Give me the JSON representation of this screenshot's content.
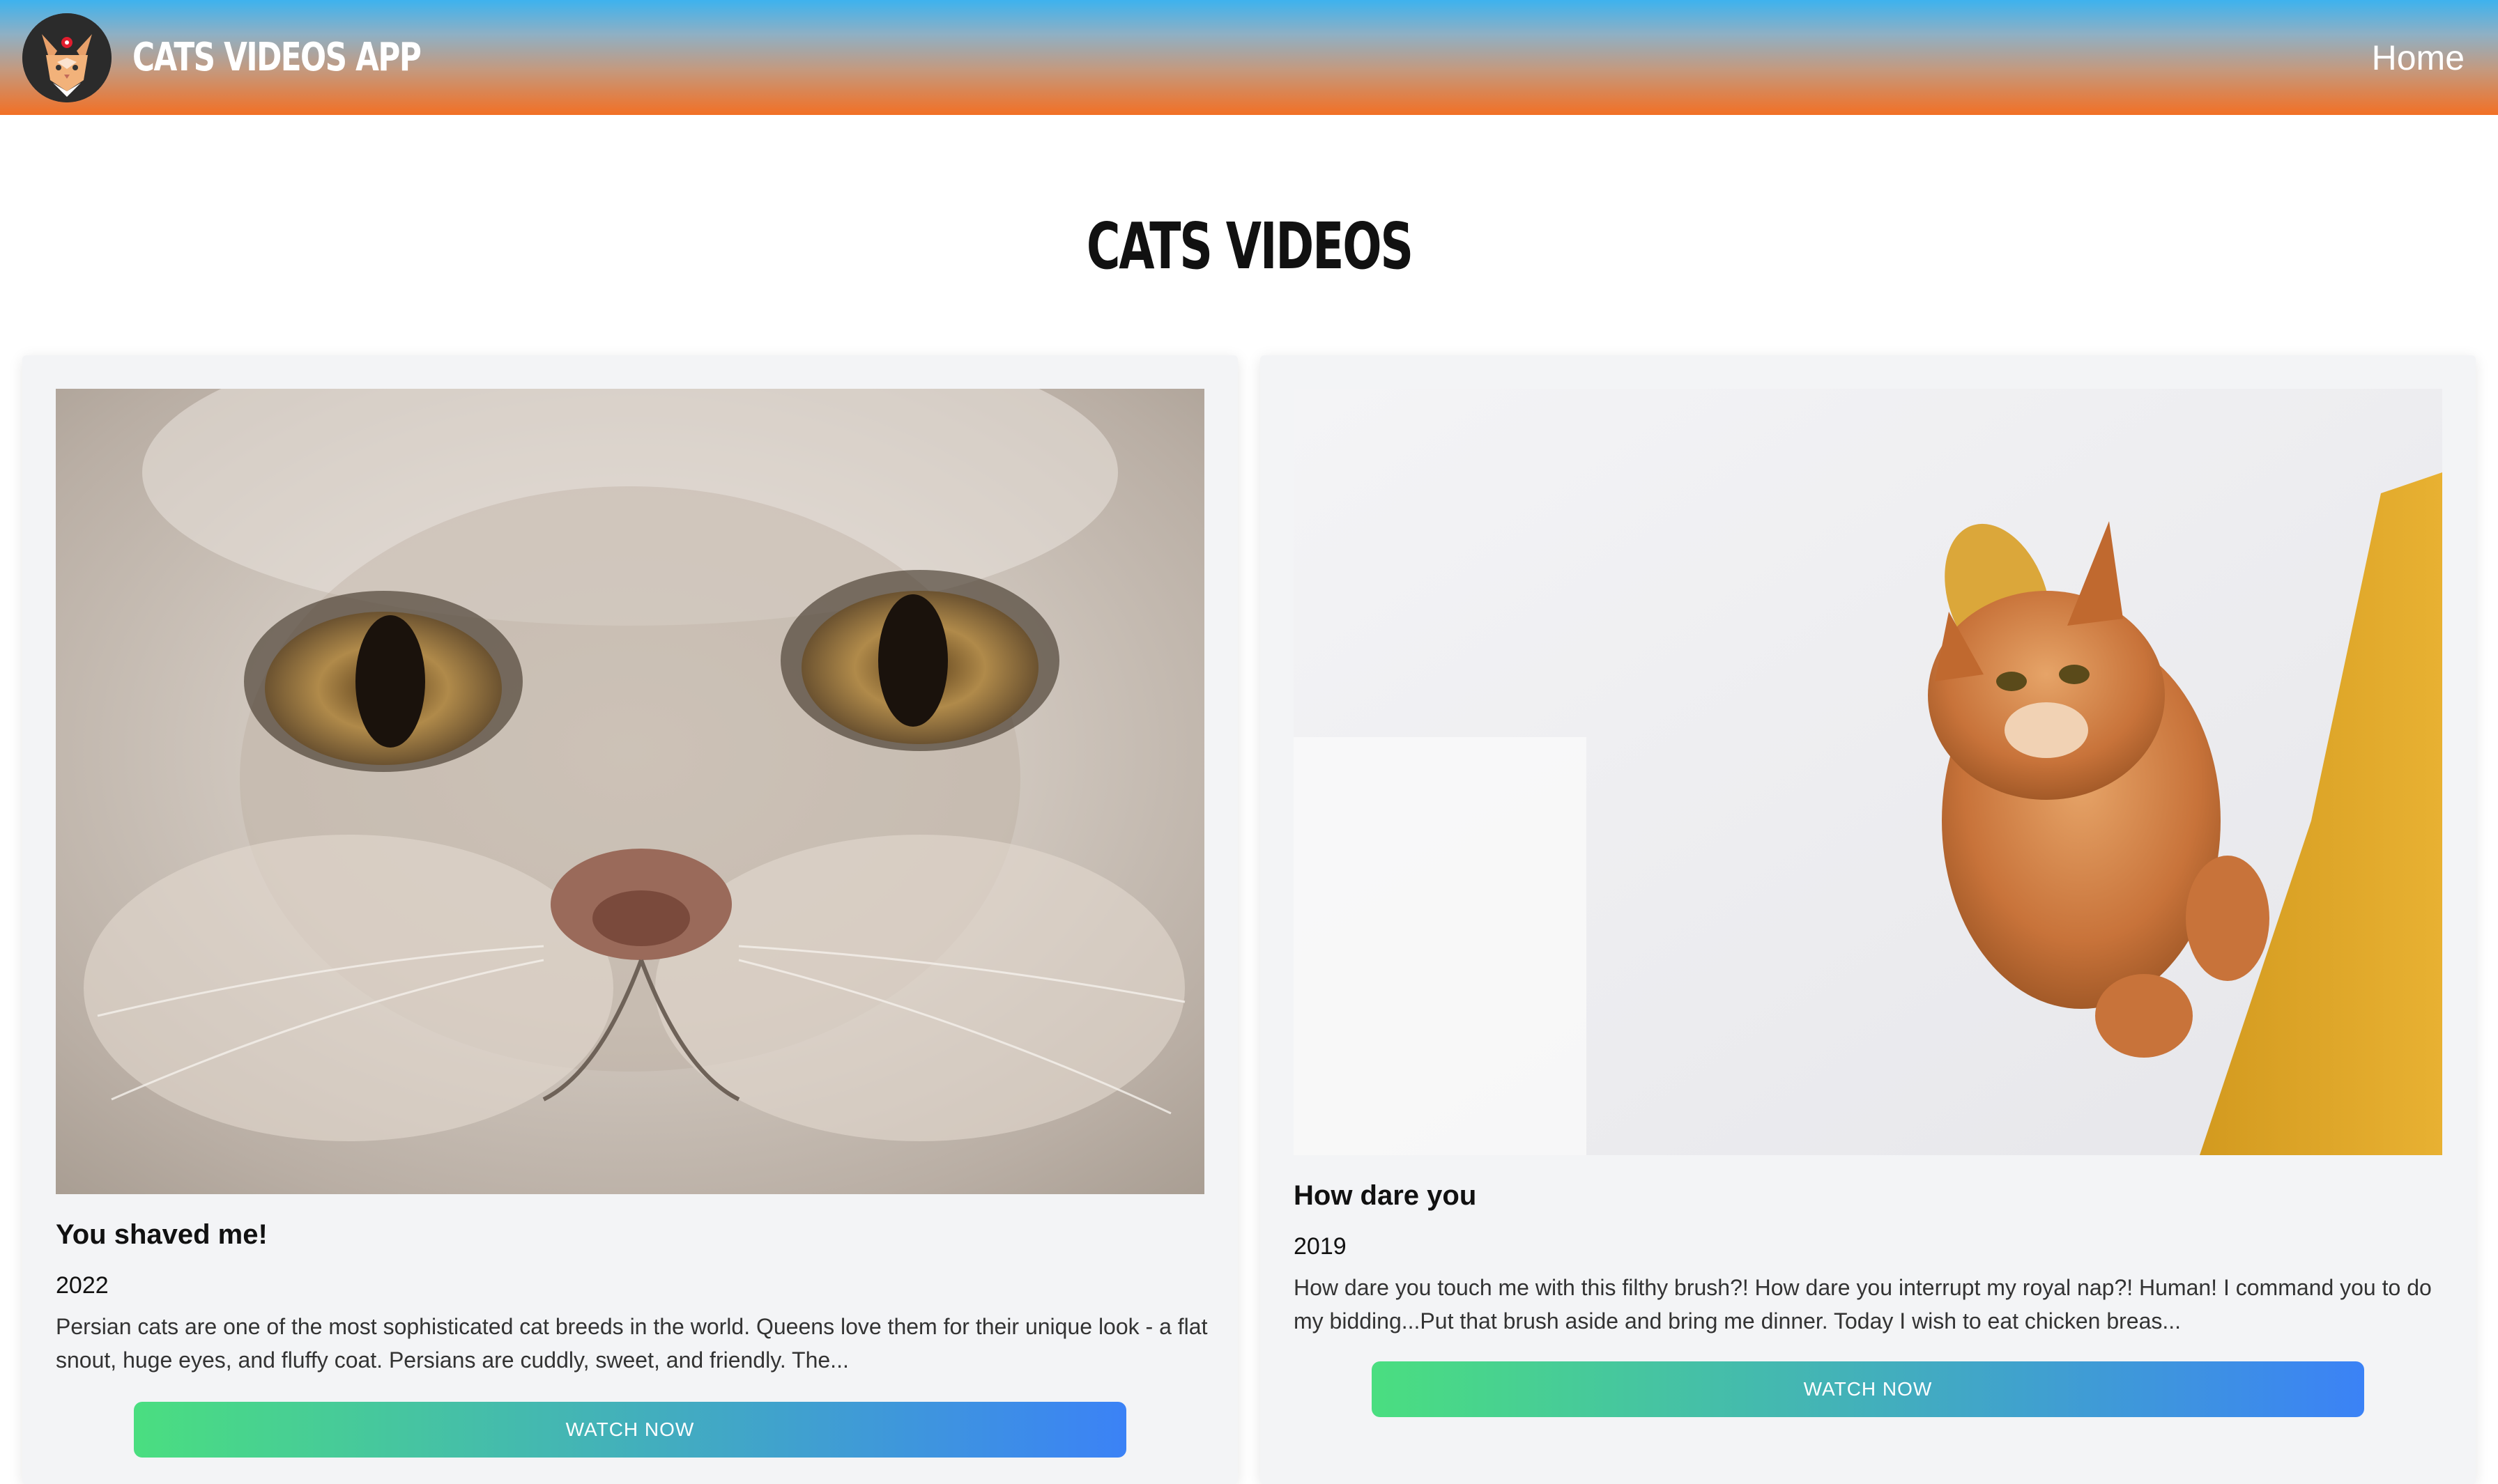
{
  "header": {
    "brand_title": "CATS VIDEOS APP",
    "nav": {
      "home_label": "Home"
    }
  },
  "main": {
    "page_title": "CATS VIDEOS",
    "videos": [
      {
        "title": "You shaved me!",
        "year": "2022",
        "description": "Persian cats are one of the most sophisticated cat breeds in the world. Queens love them for their unique look - a flat snout, huge eyes, and fluffy coat. Persians are cuddly, sweet, and friendly. The...",
        "button_label": "WATCH NOW",
        "image": "white-persian-cat-closeup-photo"
      },
      {
        "title": "How dare you",
        "year": "2019",
        "description": "How dare you touch me with this filthy brush?! How dare you interrupt my royal nap?! Human! I command you to do my bidding...Put that brush aside and bring me dinner. Today I wish to eat chicken breas...",
        "button_label": "WATCH NOW",
        "image": "orange-maine-coon-cat-on-yellow-chair-photo"
      }
    ]
  },
  "colors": {
    "header_top": "#3db2ee",
    "header_bottom": "#f27025",
    "button_start": "#4ade80",
    "button_end": "#3b82f6",
    "card_bg": "#f3f4f6"
  }
}
